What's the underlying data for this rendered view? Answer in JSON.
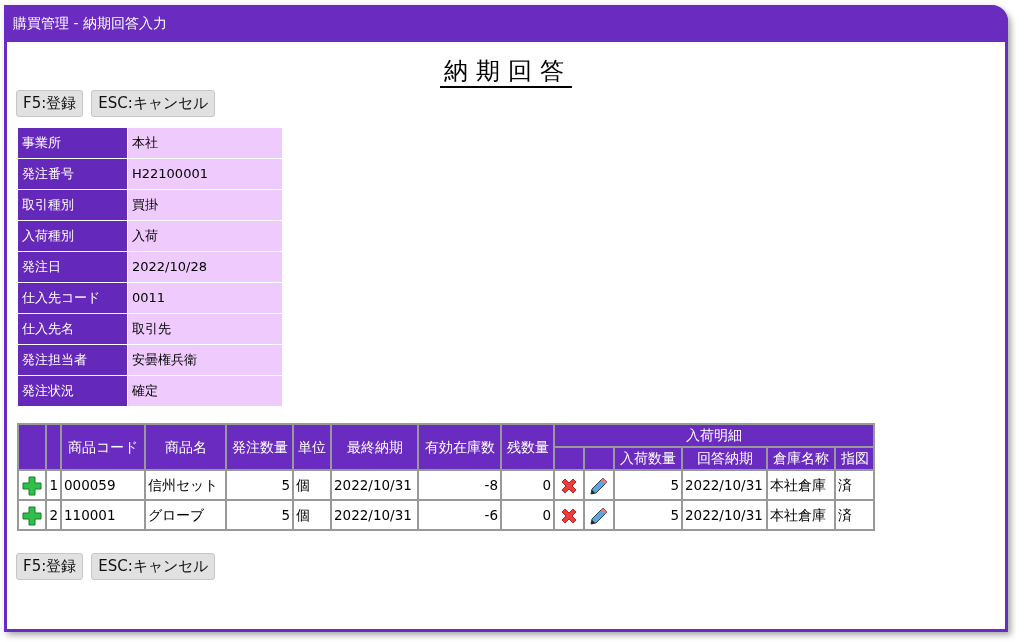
{
  "window": {
    "title": "購買管理 - 納期回答入力"
  },
  "heading": "納期回答",
  "top_buttons": [
    "F5:登録",
    "ESC:キャンセル"
  ],
  "info": [
    {
      "label": "事業所",
      "value": "本社"
    },
    {
      "label": "発注番号",
      "value": "H22100001"
    },
    {
      "label": "取引種別",
      "value": "買掛"
    },
    {
      "label": "入荷種別",
      "value": "入荷"
    },
    {
      "label": "発注日",
      "value": "2022/10/28"
    },
    {
      "label": "仕入先コード",
      "value": "0011"
    },
    {
      "label": "仕入先名",
      "value": "取引先"
    },
    {
      "label": "発注担当者",
      "value": "安曇権兵衛"
    },
    {
      "label": "発注状況",
      "value": "確定"
    }
  ],
  "table": {
    "columns": [
      "商品コード",
      "商品名",
      "発注数量",
      "単位",
      "最終納期",
      "有効在庫数",
      "残数量"
    ],
    "group": {
      "label": "入荷明細",
      "columns": [
        "入荷数量",
        "回答納期",
        "倉庫名称",
        "指図"
      ]
    },
    "rows": [
      {
        "no": "1",
        "code": "000059",
        "name": "信州セット",
        "qty": "5",
        "unit": "個",
        "last_date": "2022/10/31",
        "stock": "-8",
        "remaining": "0",
        "arrival_qty": "5",
        "answer_date": "2022/10/31",
        "warehouse": "本社倉庫",
        "instruction": "済"
      },
      {
        "no": "2",
        "code": "110001",
        "name": "グローブ",
        "qty": "5",
        "unit": "個",
        "last_date": "2022/10/31",
        "stock": "-6",
        "remaining": "0",
        "arrival_qty": "5",
        "answer_date": "2022/10/31",
        "warehouse": "本社倉庫",
        "instruction": "済"
      }
    ]
  },
  "bottom_buttons": [
    "F5:登録",
    "ESC:キャンセル"
  ]
}
